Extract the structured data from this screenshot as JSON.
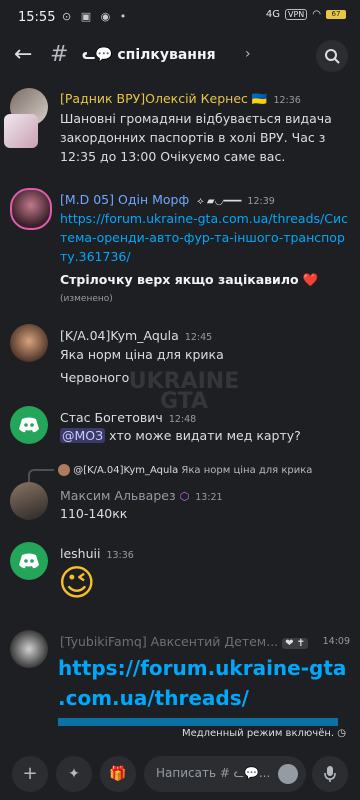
{
  "status_bar": {
    "time": "15:55",
    "icons": "⊙ ▣ ◉ •",
    "network": "4G",
    "vpn": "VPN",
    "battery": "67"
  },
  "header": {
    "channel_name": "ᓚ💬 спілкування"
  },
  "messages": [
    {
      "author": "[Радник ВРУ]Олексій Кернес 🇺🇦",
      "author_color": "#e8c447",
      "time": "12:36",
      "text": "Шановні громадяни відбувається видача закордонних паспортів в холі ВРУ. Час з 12:35 до 13:00 Очікуємо саме вас."
    },
    {
      "author": "[M.D 05] Одін Морф",
      "author_color": "#6fa8ff",
      "tag": "⟡ ▰◡━━━",
      "time": "12:39",
      "link": "https://forum.ukraine-gta.com.ua/threads/Система-оренди-авто-фур-та-іншого-транспорту.361736/",
      "bold_text": "Стрілочку верх якщо зацікавило ❤️",
      "edited": "(изменено)"
    },
    {
      "author": "[K/A.04]Kym_Aqula",
      "author_color": "#dbdee1",
      "time": "12:45",
      "lines": [
        "Яка норм ціна для крика",
        "Червоного"
      ]
    },
    {
      "author": "Стас Богетович",
      "author_color": "#dbdee1",
      "time": "12:48",
      "mention": "@МОЗ",
      "text": "хто може видати мед карту?"
    },
    {
      "reply_to_author": "@[K/A.04]Kym_Aqula",
      "reply_text": "Яка норм ціна для крика",
      "author": "Максим Альварез",
      "author_color": "#949ba4",
      "time": "13:21",
      "text": "110-140кк"
    },
    {
      "author": "leshuii",
      "author_color": "#dbdee1",
      "time": "13:36",
      "emoji": "😉"
    },
    {
      "author": "[TyubikiFamq] Авксентий Детем...",
      "author_color": "#6c6f78",
      "time": "14:09",
      "link_lines": [
        "https://forum.ukraine-gta",
        ".com.ua/threads/"
      ]
    }
  ],
  "slowmode_text": "Медленный режим включён.",
  "input": {
    "placeholder": "Написать # ᓚ💬..."
  },
  "colors": {
    "background": "#1e1f22",
    "link": "#00a8fc",
    "discord_green": "#23a55a"
  }
}
